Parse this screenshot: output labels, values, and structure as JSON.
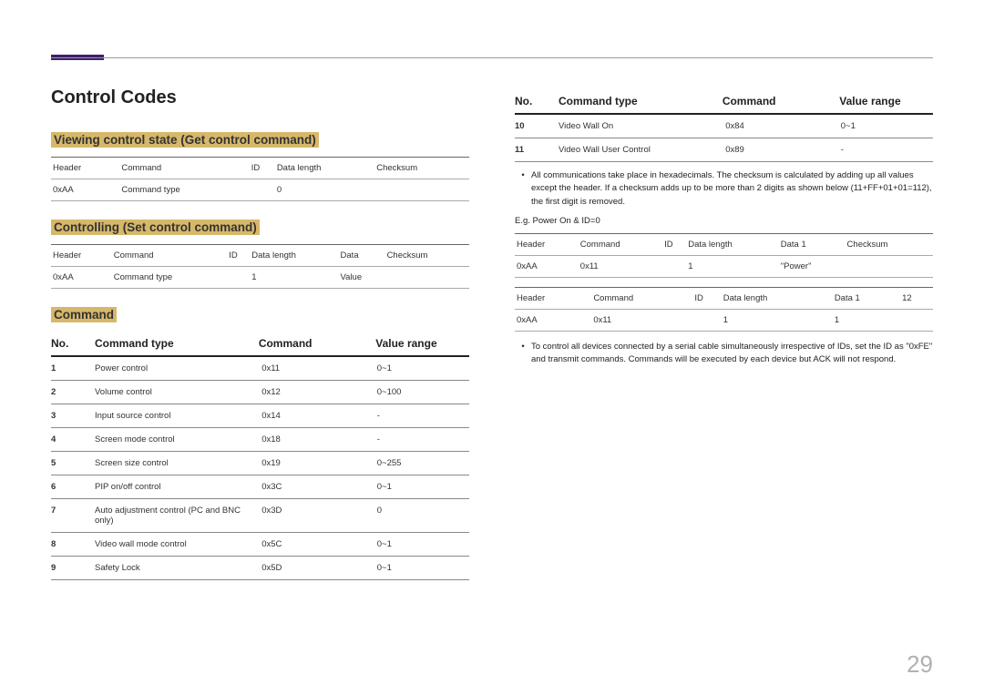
{
  "page_number": "29",
  "title": "Control Codes",
  "h_view": "Viewing control state (Get control command)",
  "h_set": "Controlling (Set control command)",
  "h_command": "Command",
  "table_get": {
    "headers": [
      "Header",
      "Command",
      "ID",
      "Data length",
      "Checksum"
    ],
    "row": [
      "0xAA",
      "Command type",
      "",
      "0",
      ""
    ]
  },
  "table_set": {
    "headers": [
      "Header",
      "Command",
      "ID",
      "Data length",
      "Data",
      "Checksum"
    ],
    "row": [
      "0xAA",
      "Command type",
      "",
      "1",
      "Value",
      ""
    ]
  },
  "cmd_headers": {
    "no": "No.",
    "type": "Command type",
    "cmd": "Command",
    "range": "Value range"
  },
  "left_rows": [
    {
      "no": "1",
      "type": "Power control",
      "cmd": "0x11",
      "range": "0~1"
    },
    {
      "no": "2",
      "type": "Volume control",
      "cmd": "0x12",
      "range": "0~100"
    },
    {
      "no": "3",
      "type": "Input source control",
      "cmd": "0x14",
      "range": "-"
    },
    {
      "no": "4",
      "type": "Screen mode control",
      "cmd": "0x18",
      "range": "-"
    },
    {
      "no": "5",
      "type": "Screen size control",
      "cmd": "0x19",
      "range": "0~255"
    },
    {
      "no": "6",
      "type": "PIP on/off control",
      "cmd": "0x3C",
      "range": "0~1"
    },
    {
      "no": "7",
      "type": "Auto adjustment control (PC and BNC only)",
      "cmd": "0x3D",
      "range": "0"
    },
    {
      "no": "8",
      "type": "Video wall mode control",
      "cmd": "0x5C",
      "range": "0~1"
    },
    {
      "no": "9",
      "type": "Safety Lock",
      "cmd": "0x5D",
      "range": "0~1"
    }
  ],
  "right_rows": [
    {
      "no": "10",
      "type": "Video Wall On",
      "cmd": "0x84",
      "range": "0~1"
    },
    {
      "no": "11",
      "type": "Video Wall User Control",
      "cmd": "0x89",
      "range": "-"
    }
  ],
  "bullet1": "All communications take place in hexadecimals. The checksum is calculated by adding up all values except the header. If a checksum adds up to be more than 2 digits as shown below (11+FF+01+01=112), the first digit is removed.",
  "eg_label": "E.g. Power On & ID=0",
  "ex_table1": {
    "headers": [
      "Header",
      "Command",
      "ID",
      "Data length",
      "Data 1",
      "Checksum"
    ],
    "row": [
      "0xAA",
      "0x11",
      "",
      "1",
      "\"Power\"",
      ""
    ]
  },
  "ex_table2": {
    "headers": [
      "Header",
      "Command",
      "ID",
      "Data length",
      "Data 1",
      "12"
    ],
    "row": [
      "0xAA",
      "0x11",
      "",
      "1",
      "1",
      ""
    ]
  },
  "bullet2": "To control all devices connected by a serial cable simultaneously irrespective of IDs, set the ID as \"0xFE\" and transmit commands. Commands will be executed by each device but ACK will not respond."
}
